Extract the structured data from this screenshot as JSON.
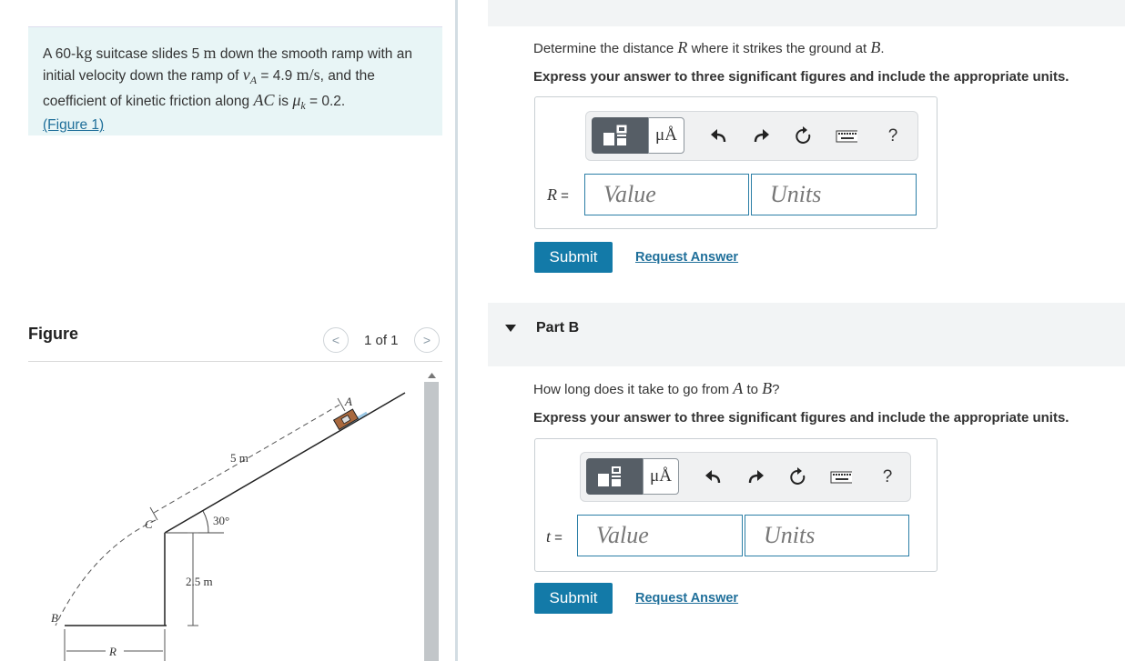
{
  "problem": {
    "t1": "A 60-",
    "kg": "kg",
    "t2": " suitcase slides 5 ",
    "m1": "m",
    "t3": " down the smooth ramp with an initial velocity down the ramp of ",
    "vA": "v",
    "vA_sub": "A",
    "t4": " = 4.9 ",
    "ms": "m/s",
    "t5": ", and the coefficient of kinetic friction along ",
    "AC": "AC",
    "t6": " is ",
    "mu": "μ",
    "mu_sub": "k",
    "t7": " = 0.2.",
    "figure_link": "(Figure 1)"
  },
  "figure_panel": {
    "title": "Figure",
    "count": "1 of 1",
    "prev_glyph": "<",
    "next_glyph": ">",
    "labels": {
      "A": "A",
      "five_m": "5 m",
      "C": "C",
      "angle": "30°",
      "height": "2.5 m",
      "B": "B",
      "R": "R"
    }
  },
  "part_a": {
    "q1": "Determine the distance ",
    "qR": "R",
    "q2": " where it strikes the ground at ",
    "qB": "B",
    "q3": ".",
    "instruction": "Express your answer to three significant figures and include the appropriate units.",
    "var": "R",
    "eq": " =",
    "value_placeholder": "Value",
    "units_placeholder": "Units",
    "submit": "Submit",
    "request": "Request Answer"
  },
  "part_b": {
    "title": "Part B",
    "q1": "How long does it take to go from ",
    "qA": "A",
    "q2": " to ",
    "qB": "B",
    "q3": "?",
    "instruction": "Express your answer to three significant figures and include the appropriate units.",
    "var": "t",
    "eq": " =",
    "value_placeholder": "Value",
    "units_placeholder": "Units",
    "submit": "Submit",
    "request": "Request Answer"
  },
  "toolbar": {
    "mu_label": "μÅ",
    "help": "?",
    "icons": [
      "templates-icon",
      "units-icon",
      "undo-icon",
      "redo-icon",
      "reset-icon",
      "keyboard-icon",
      "help-icon"
    ]
  },
  "colors": {
    "accent": "#137aa8",
    "problem_bg": "#e8f5f6",
    "link": "#1f6f9a"
  }
}
